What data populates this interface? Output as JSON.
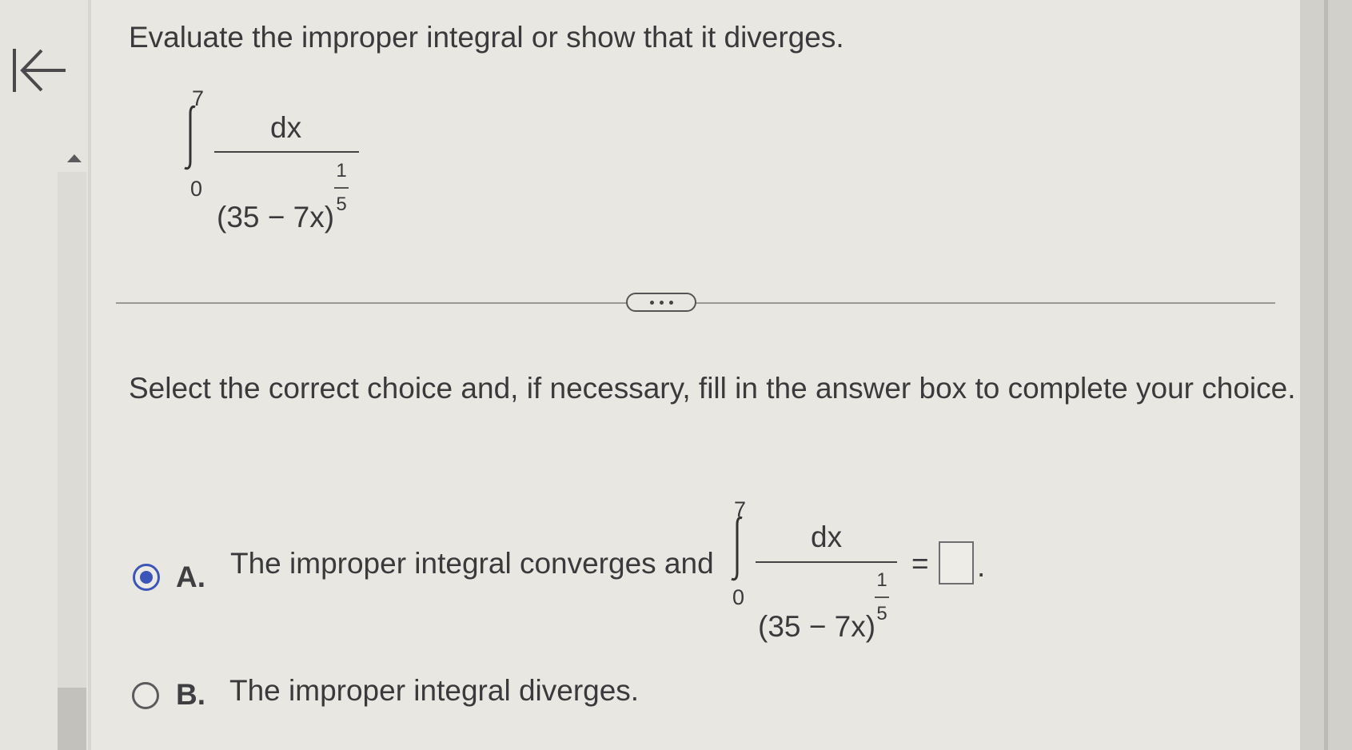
{
  "question": {
    "prompt": "Evaluate the improper integral or show that it diverges.",
    "integral": {
      "upper": "7",
      "lower": "0",
      "numerator": "dx",
      "denominator_base": "(35 − 7x)",
      "exponent_num": "1",
      "exponent_den": "5"
    }
  },
  "toolbar": {
    "back_icon": "back-to-start-icon",
    "more_icon": "ellipsis-icon"
  },
  "instruction": "Select the correct choice and, if necessary, fill in the answer box to complete your choice.",
  "choices": {
    "a": {
      "letter": "A.",
      "text": "The improper integral converges and",
      "selected": true,
      "equals": "=",
      "answer_value": "",
      "trailing": "."
    },
    "b": {
      "letter": "B.",
      "text": "The improper integral diverges.",
      "selected": false
    }
  },
  "colors": {
    "background": "#e9e7e1",
    "accent": "#3b56b8",
    "text": "#3a3a3c"
  }
}
